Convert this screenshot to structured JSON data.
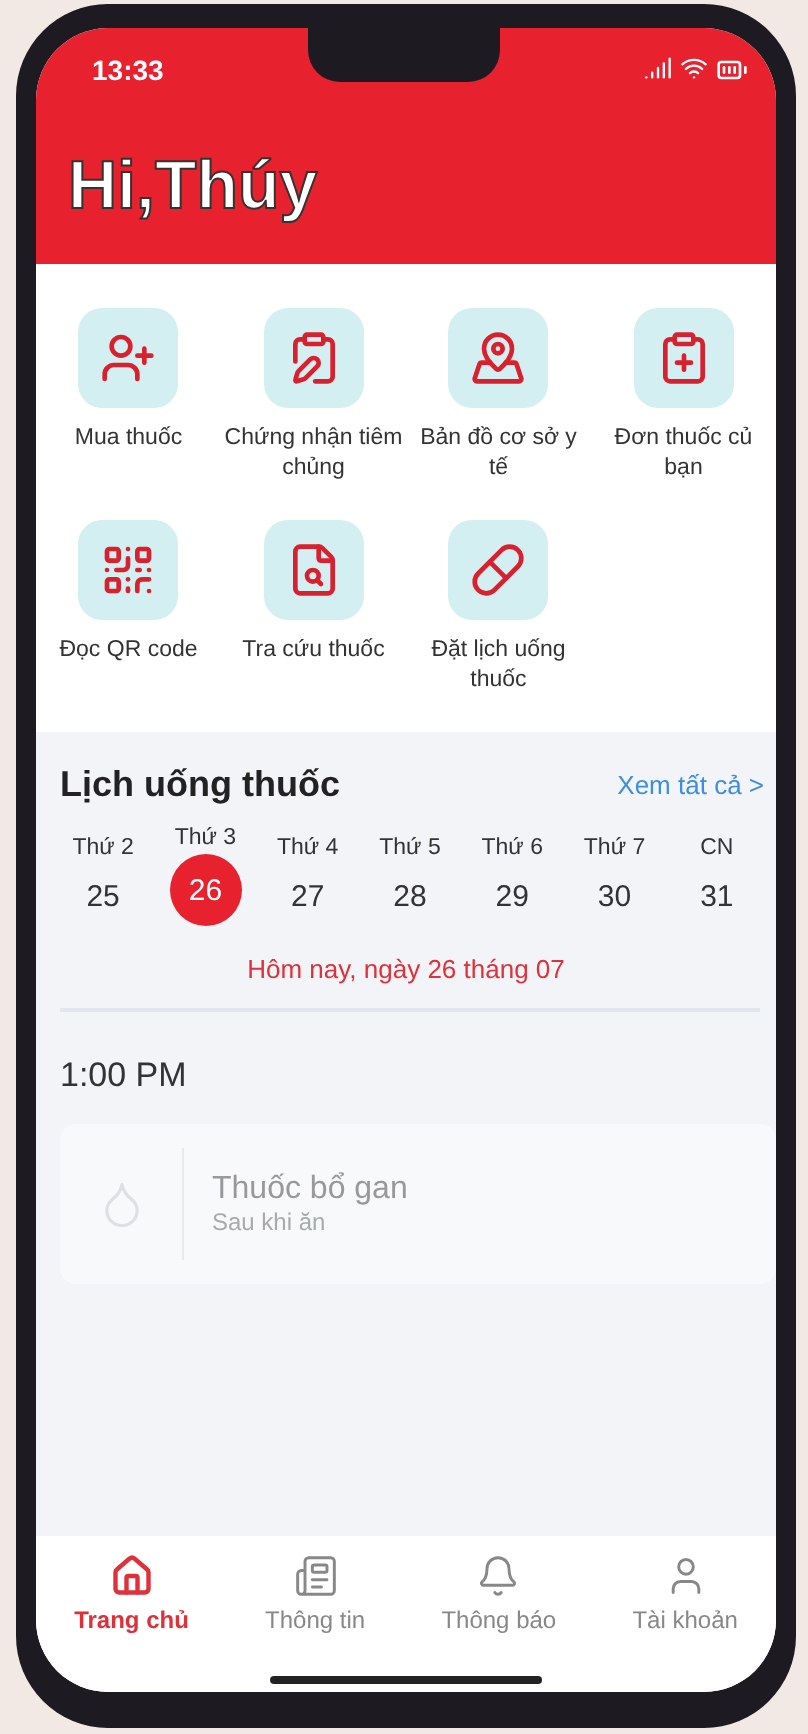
{
  "status_bar": {
    "time": "13:33"
  },
  "header": {
    "greeting": "Hi,Thúy"
  },
  "services": [
    {
      "label": "Mua thuốc"
    },
    {
      "label": "Chứng nhận tiêm chủng"
    },
    {
      "label": "Bản đồ cơ sở y tế"
    },
    {
      "label": "Đơn thuốc củ bạn"
    },
    {
      "label": "Đọc QR code"
    },
    {
      "label": "Tra cứu thuốc"
    },
    {
      "label": "Đặt lịch uống thuốc"
    }
  ],
  "schedule": {
    "title": "Lịch uống thuốc",
    "see_all": "Xem tất cả >",
    "days": [
      {
        "weekday": "Thứ 2",
        "date": "25",
        "selected": false
      },
      {
        "weekday": "Thứ 3",
        "date": "26",
        "selected": true
      },
      {
        "weekday": "Thứ 4",
        "date": "27",
        "selected": false
      },
      {
        "weekday": "Thứ 5",
        "date": "28",
        "selected": false
      },
      {
        "weekday": "Thứ 6",
        "date": "29",
        "selected": false
      },
      {
        "weekday": "Thứ 7",
        "date": "30",
        "selected": false
      },
      {
        "weekday": "CN",
        "date": "31",
        "selected": false
      }
    ],
    "today": "Hôm nay, ngày 26 tháng 07",
    "time": "1:00 PM",
    "medicine": {
      "name": "Thuốc bổ gan",
      "note": "Sau khi ăn"
    }
  },
  "bottom_nav": [
    {
      "label": "Trang chủ",
      "selected": true
    },
    {
      "label": "Thông tin",
      "selected": false
    },
    {
      "label": "Thông báo",
      "selected": false
    },
    {
      "label": "Tài khoản",
      "selected": false
    }
  ]
}
